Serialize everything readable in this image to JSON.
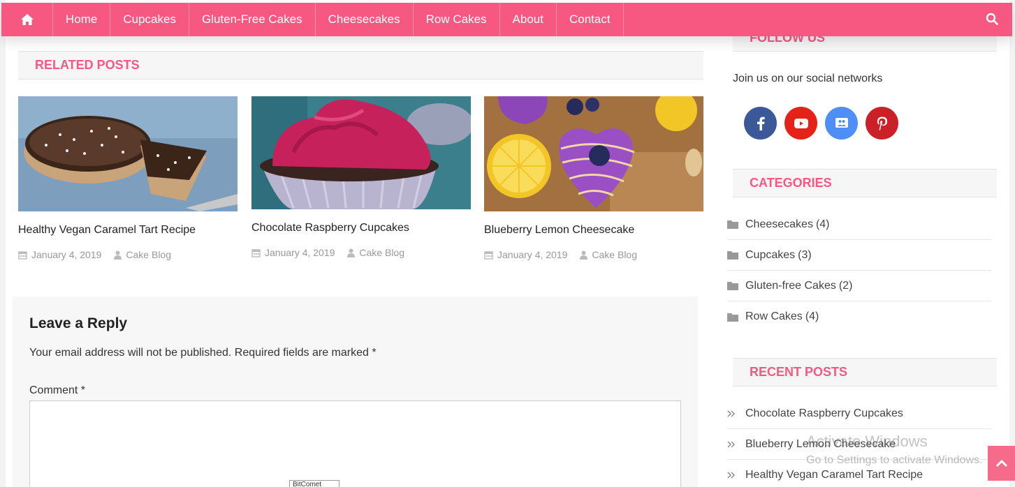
{
  "nav": {
    "home_icon": "home-icon",
    "items": [
      "Home",
      "Cupcakes",
      "Gluten-Free Cakes",
      "Cheesecakes",
      "Row Cakes",
      "About",
      "Contact"
    ],
    "search_icon": "search-icon"
  },
  "colors": {
    "accent": "#f65882",
    "facebook": "#3b5998",
    "youtube": "#e62117",
    "google": "#4e8ef7",
    "pinterest": "#cb2027"
  },
  "related": {
    "title": "RELATED POSTS",
    "posts": [
      {
        "title": "Healthy Vegan Caramel Tart Recipe",
        "date": "January 4, 2019",
        "author": "Cake Blog"
      },
      {
        "title": "Chocolate Raspberry Cupcakes",
        "date": "January 4, 2019",
        "author": "Cake Blog"
      },
      {
        "title": "Blueberry Lemon Cheesecake",
        "date": "January 4, 2019",
        "author": "Cake Blog"
      }
    ]
  },
  "reply": {
    "title": "Leave a Reply",
    "notice": "Your email address will not be published. Required fields are marked *",
    "comment_label": "Comment *",
    "comment_value": ""
  },
  "bitcomet": "BitComet",
  "sidebar": {
    "follow_title": "FOLLOW US",
    "follow_text": "Join us on our social networks",
    "social_icons": [
      "facebook-icon",
      "youtube-icon",
      "google-icon",
      "pinterest-icon"
    ],
    "categories_title": "CATEGORIES",
    "categories": [
      {
        "name": "Cheesecakes",
        "count": "(4)"
      },
      {
        "name": "Cupcakes",
        "count": "(3)"
      },
      {
        "name": "Gluten-free Cakes",
        "count": "(2)"
      },
      {
        "name": "Row Cakes",
        "count": "(4)"
      }
    ],
    "recent_title": "RECENT POSTS",
    "recent": [
      "Chocolate Raspberry Cupcakes",
      "Blueberry Lemon Cheesecake",
      "Healthy Vegan Caramel Tart Recipe"
    ]
  },
  "watermark": {
    "line1": "Activate Windows",
    "line2": "Go to Settings to activate Windows."
  }
}
